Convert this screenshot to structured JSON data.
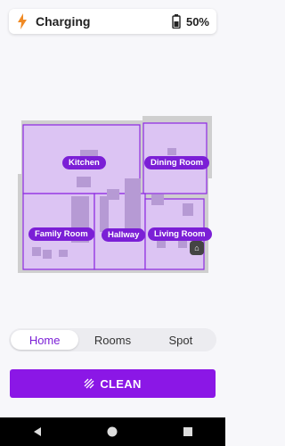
{
  "status": {
    "label": "Charging",
    "battery": "50%"
  },
  "map": {
    "rooms": {
      "kitchen": "Kitchen",
      "dining": "Dining Room",
      "family": "Family Room",
      "hallway": "Hallway",
      "living": "Living Room"
    }
  },
  "tabs": {
    "home": "Home",
    "rooms": "Rooms",
    "spot": "Spot"
  },
  "action": {
    "clean": "CLEAN"
  },
  "colors": {
    "accent": "#8b17e6",
    "room_fill": "#dcc4f3",
    "room_outline": "#8e2be2"
  }
}
